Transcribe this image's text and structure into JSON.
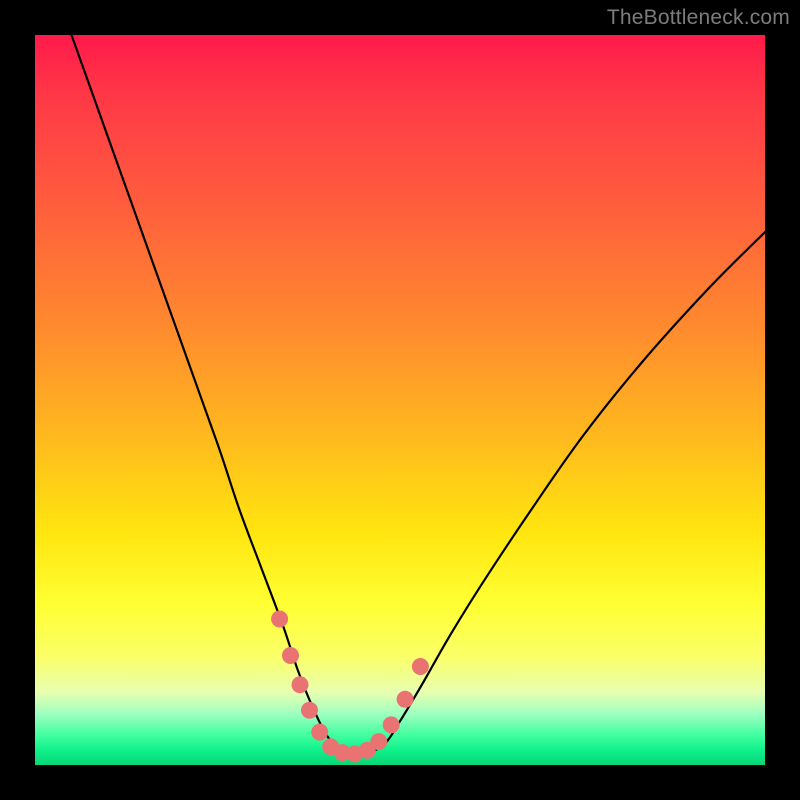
{
  "watermark": "TheBottleneck.com",
  "colors": {
    "frame": "#000000",
    "marker": "#e97373",
    "curve": "#000000"
  },
  "chart_data": {
    "type": "line",
    "title": "",
    "xlabel": "",
    "ylabel": "",
    "xlim": [
      0,
      100
    ],
    "ylim": [
      0,
      100
    ],
    "grid": false,
    "legend": false,
    "note": "Bottleneck-style curve. x is horizontal position (percent of plot width), y is curve height (percent of plot height, 0 at bottom). Curve descends from top-left, reaches a flat minimum near x≈39–47, then rises toward upper-right.",
    "series": [
      {
        "name": "curve",
        "x": [
          5,
          10,
          15,
          20,
          25,
          28,
          31,
          34,
          36,
          38,
          40,
          42,
          44,
          46,
          48,
          50,
          53,
          57,
          62,
          68,
          75,
          83,
          92,
          100
        ],
        "y": [
          100,
          86,
          72,
          58,
          44,
          35,
          27,
          19,
          13,
          8,
          4,
          2,
          1.5,
          1.8,
          3,
          6,
          11,
          18,
          26,
          35,
          45,
          55,
          65,
          73
        ]
      }
    ],
    "markers": {
      "name": "highlight-dots",
      "color": "#e97373",
      "points": [
        {
          "x": 33.5,
          "y": 20
        },
        {
          "x": 35.0,
          "y": 15
        },
        {
          "x": 36.3,
          "y": 11
        },
        {
          "x": 37.6,
          "y": 7.5
        },
        {
          "x": 39.0,
          "y": 4.5
        },
        {
          "x": 40.5,
          "y": 2.5
        },
        {
          "x": 42.1,
          "y": 1.7
        },
        {
          "x": 43.8,
          "y": 1.5
        },
        {
          "x": 45.5,
          "y": 2.0
        },
        {
          "x": 47.1,
          "y": 3.2
        },
        {
          "x": 48.8,
          "y": 5.5
        },
        {
          "x": 50.7,
          "y": 9.0
        },
        {
          "x": 52.8,
          "y": 13.5
        }
      ]
    }
  }
}
